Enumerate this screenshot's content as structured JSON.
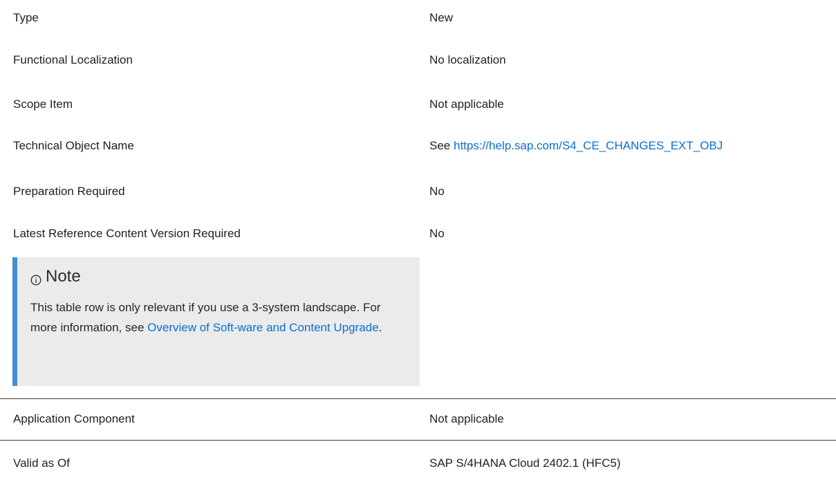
{
  "rows": [
    {
      "label": "Type",
      "value": "New"
    },
    {
      "label": "Functional Localization",
      "value": "No localization"
    },
    {
      "label": "Scope Item",
      "value": "Not applicable"
    },
    {
      "label": "Technical Object Name",
      "value_prefix": "See ",
      "value_link": "https://help.sap.com/S4_CE_CHANGES_EXT_OBJ"
    },
    {
      "label": "Preparation Required",
      "value": "No"
    },
    {
      "label": "Latest Reference Content Version Required",
      "value": "No"
    },
    {
      "label": "Application Component",
      "value": "Not applicable"
    },
    {
      "label": "Valid as Of",
      "value": "SAP S/4HANA Cloud 2402.1 (HFC5)"
    }
  ],
  "note": {
    "icon": "info-circle-icon",
    "title": "Note",
    "body_part1": "This table row is only relevant if you use a 3-system landscape. For more information, see ",
    "body_link": "Overview of Soft-ware and Content Upgrade",
    "body_part2": "."
  },
  "colors": {
    "link": "#0a6ed1",
    "note_border": "#3f8fd2",
    "note_background": "#ebebeb",
    "divider": "#3a3a3a"
  }
}
